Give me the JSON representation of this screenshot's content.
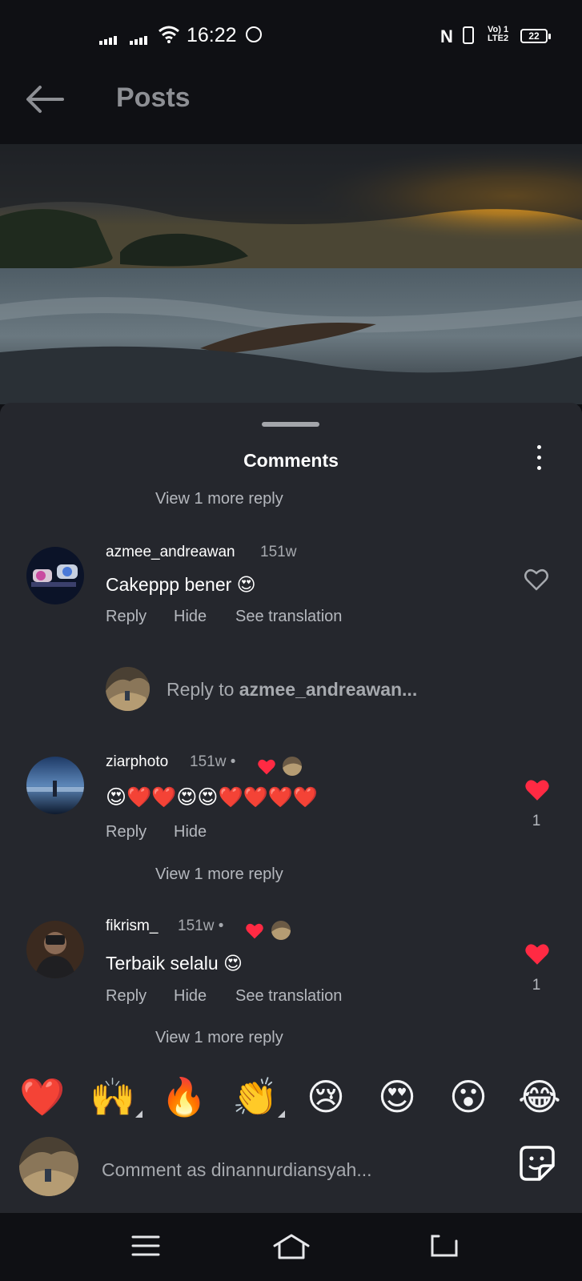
{
  "status_bar": {
    "time": "16:22",
    "volte": "Vo) 1\nLTE2",
    "battery": "22"
  },
  "header": {
    "back_icon": "arrow-left-icon",
    "title": "Posts"
  },
  "sheet": {
    "title": "Comments"
  },
  "comments": [
    {
      "view_more": "View 1 more reply"
    },
    {
      "username": "azmee_andreawan",
      "time": "151w",
      "text": "Cakeppp bener 😍",
      "actions": [
        "Reply",
        "Hide",
        "See translation"
      ],
      "reply_placeholder_prefix": "Reply to ",
      "reply_placeholder_user": "azmee_andreawan..."
    },
    {
      "username": "ziarphoto",
      "time": "151w •",
      "text": "😍❤️❤️😍😍❤️❤️❤️❤️",
      "actions": [
        "Reply",
        "Hide"
      ],
      "likes": "1",
      "view_more": "View 1 more reply"
    },
    {
      "username": "fikrism_",
      "time": "151w •",
      "text": "Terbaik selalu 😍",
      "actions": [
        "Reply",
        "Hide",
        "See translation"
      ],
      "likes": "1",
      "view_more": "View 1 more reply"
    }
  ],
  "emoji_bar": [
    "❤️",
    "🙌",
    "🔥",
    "👏",
    "😢",
    "😍",
    "😮",
    "😂"
  ],
  "comment_input": {
    "placeholder": "Comment as dinannurdiansyah..."
  },
  "colors": {
    "like_red": "#ff2a43",
    "sheet_bg": "#25272d",
    "bg": "#0f1014"
  }
}
